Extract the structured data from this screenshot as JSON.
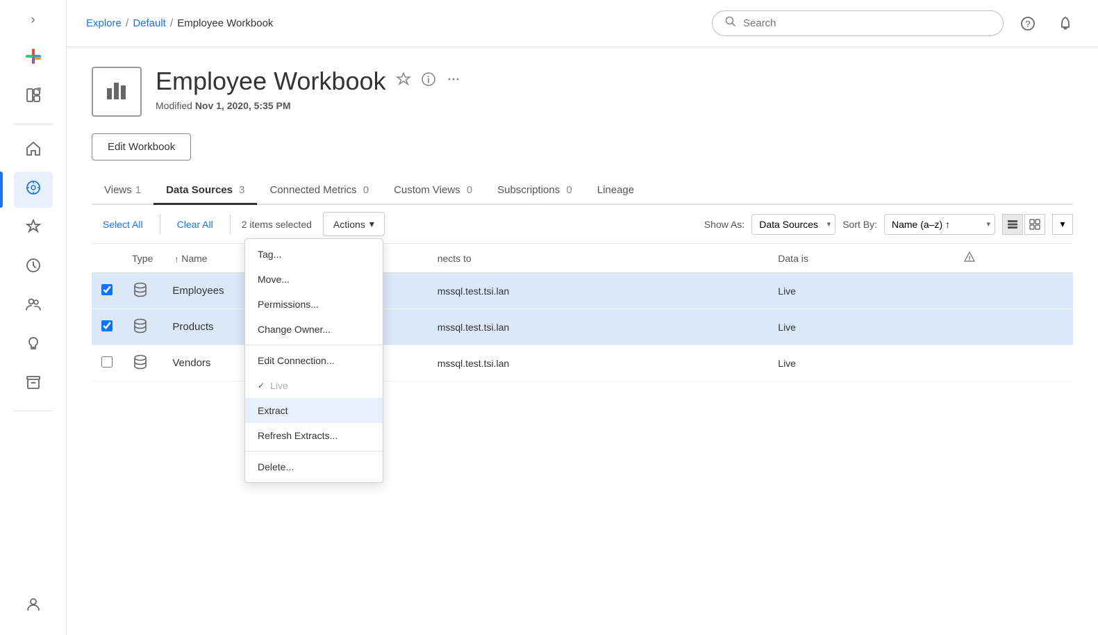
{
  "sidebar": {
    "toggle_label": "›",
    "items": [
      {
        "id": "colorful-logo",
        "icon": "✦",
        "label": "Logo",
        "active": false
      },
      {
        "id": "layout",
        "icon": "⊞",
        "label": "Layout",
        "active": false
      },
      {
        "id": "home",
        "icon": "⌂",
        "label": "Home",
        "active": false
      },
      {
        "id": "discover",
        "icon": "◎",
        "label": "Discover",
        "active": true
      },
      {
        "id": "favorites",
        "icon": "☆",
        "label": "Favorites",
        "active": false
      },
      {
        "id": "recents",
        "icon": "⏱",
        "label": "Recents",
        "active": false
      },
      {
        "id": "users",
        "icon": "👥",
        "label": "Users",
        "active": false
      },
      {
        "id": "bulb",
        "icon": "💡",
        "label": "Recommendations",
        "active": false
      },
      {
        "id": "archive",
        "icon": "🗄",
        "label": "Archive",
        "active": false
      }
    ],
    "bottom_item": {
      "icon": "👤",
      "label": "Users"
    }
  },
  "topbar": {
    "breadcrumb": {
      "explore": "Explore",
      "default": "Default",
      "current": "Employee Workbook"
    },
    "search_placeholder": "Search",
    "help_icon": "?",
    "bell_icon": "🔔"
  },
  "workbook": {
    "title": "Employee Workbook",
    "modified_label": "Modified",
    "modified_date": "Nov 1, 2020, 5:35 PM",
    "edit_button": "Edit Workbook"
  },
  "tabs": [
    {
      "id": "views",
      "label": "Views",
      "count": "1",
      "active": false
    },
    {
      "id": "data-sources",
      "label": "Data Sources",
      "count": "3",
      "active": true
    },
    {
      "id": "connected-metrics",
      "label": "Connected Metrics",
      "count": "0",
      "active": false
    },
    {
      "id": "custom-views",
      "label": "Custom Views",
      "count": "0",
      "active": false
    },
    {
      "id": "subscriptions",
      "label": "Subscriptions",
      "count": "0",
      "active": false
    },
    {
      "id": "lineage",
      "label": "Lineage",
      "count": "",
      "active": false
    }
  ],
  "toolbar": {
    "select_all": "Select All",
    "clear_all": "Clear All",
    "selected_count": "2 items selected",
    "actions_label": "Actions",
    "show_as_label": "Show As:",
    "show_as_value": "Data Sources",
    "sort_by_label": "Sort By:",
    "sort_by_value": "Name (a–z) ↑"
  },
  "table": {
    "columns": [
      {
        "id": "checkbox",
        "label": ""
      },
      {
        "id": "type",
        "label": "Type"
      },
      {
        "id": "name",
        "label": "Name",
        "sortable": true,
        "sort_dir": "↑"
      },
      {
        "id": "connects_to",
        "label": "nects to"
      },
      {
        "id": "data_is",
        "label": "Data is"
      },
      {
        "id": "warning",
        "label": "⚠"
      }
    ],
    "rows": [
      {
        "id": "employees",
        "checked": true,
        "name": "Employees",
        "connects_to": "mssql.test.tsi.lan",
        "data_is": "Live",
        "selected": true
      },
      {
        "id": "products",
        "checked": true,
        "name": "Products",
        "connects_to": "mssql.test.tsi.lan",
        "data_is": "Live",
        "selected": true
      },
      {
        "id": "vendors",
        "checked": false,
        "name": "Vendors",
        "connects_to": "mssql.test.tsi.lan",
        "data_is": "Live",
        "selected": false
      }
    ]
  },
  "dropdown": {
    "items": [
      {
        "id": "tag",
        "label": "Tag...",
        "group": 1,
        "highlighted": false,
        "disabled": false
      },
      {
        "id": "move",
        "label": "Move...",
        "group": 1,
        "highlighted": false,
        "disabled": false
      },
      {
        "id": "permissions",
        "label": "Permissions...",
        "group": 1,
        "highlighted": false,
        "disabled": false
      },
      {
        "id": "change-owner",
        "label": "Change Owner...",
        "group": 1,
        "highlighted": false,
        "disabled": false
      },
      {
        "id": "edit-connection",
        "label": "Edit Connection...",
        "group": 2,
        "highlighted": false,
        "disabled": false
      },
      {
        "id": "live",
        "label": "Live",
        "group": 2,
        "highlighted": false,
        "disabled": true,
        "check": true
      },
      {
        "id": "extract",
        "label": "Extract",
        "group": 2,
        "highlighted": true,
        "disabled": false
      },
      {
        "id": "refresh-extracts",
        "label": "Refresh Extracts...",
        "group": 2,
        "highlighted": false,
        "disabled": false
      },
      {
        "id": "delete",
        "label": "Delete...",
        "group": 3,
        "highlighted": false,
        "disabled": false
      }
    ]
  }
}
